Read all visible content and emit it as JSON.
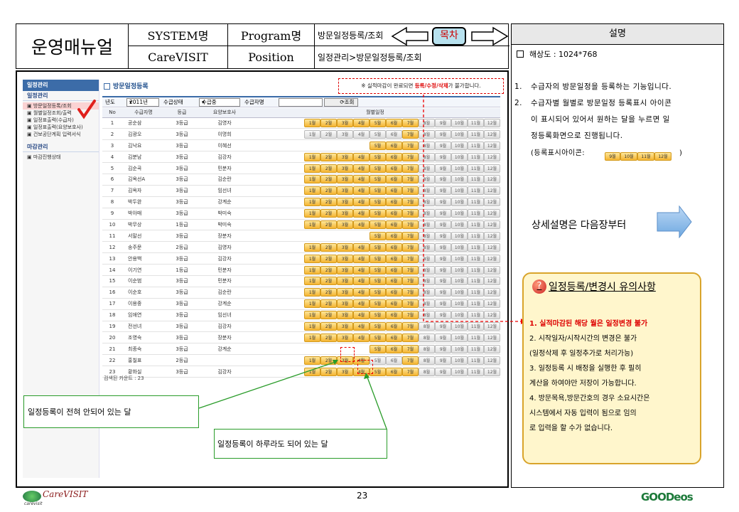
{
  "header": {
    "doc_title": "운영매뉴얼",
    "system_label": "SYSTEM명",
    "program_label": "Program명",
    "program_value": "방문일정등록/조회",
    "mokcha": "목차",
    "system_value": "CareVISIT",
    "position_label": "Position",
    "position_value": "일정관리>방문일정등록/조회"
  },
  "desc": {
    "head": "설명",
    "resolution": "해상도 : 1024*768",
    "item1_num": "1.",
    "item1": "수급자의 방문일정을 등록하는 기능입니다.",
    "item2_num": "2.",
    "item2_l1": "수급자별 월별로 방문일정 등록표시 아이콘",
    "item2_l2": "이 표시되어 있어서 원하는 달을 누르면 일",
    "item2_l3": "정등록화면으로 진행됩니다.",
    "item2_l4": "(등록표시아이콘:",
    "item2_l4_end": ")",
    "icon_samples": [
      "9월",
      "10월",
      "11월",
      "12월"
    ],
    "detail": "상세설명은 다음장부터"
  },
  "note": {
    "title": "일정등록/변경시 유의사항",
    "items": [
      "1.   실적마감된 해당 월은 일정변경 불가",
      "2.   시작일자/시작시간의 변경은 불가",
      "      (일정삭제 후 일정추가로 처리가능)",
      "3.   일정등록 시 배정을 실행한 후 필히",
      "      계산을 하여야만 저장이 가능합니다.",
      "4.   방문목욕,방문간호의 경우 소요시간은",
      "      시스템에서 자동 입력이 됨으로 임의",
      "      로 입력을 할 수가 없습니다."
    ]
  },
  "sidebar": {
    "head1": "일정관리",
    "sub1": "일정관리",
    "items": [
      "방문일정등록/조회",
      "월별일정조회/출력",
      "일정표출력(수급자)",
      "일정표출력(요양보호사)",
      "건보공단계획 입력서식"
    ],
    "head2": "마감관리",
    "items2": [
      "마감진행상태"
    ]
  },
  "screen": {
    "title": "방문일정등록",
    "warn_pre": "※ 실적마감이 완료되면",
    "warn_red": "등록/수정/삭제",
    "warn_post": "가 불가합니다.",
    "f_year_label": "년도",
    "f_year": "2011년",
    "f_status_label": "수급상태",
    "f_status": "수급중",
    "f_name_label": "수급자명",
    "f_search": "조회",
    "cols": [
      "No",
      "수급자명",
      "등급",
      "요양보호사",
      "월별일정"
    ],
    "count": "검색된 카운트 : 23"
  },
  "months": [
    "1월",
    "2월",
    "3월",
    "4월",
    "5월",
    "6월",
    "7월",
    "8월",
    "9월",
    "10월",
    "11월",
    "12월"
  ],
  "rows": [
    {
      "no": "1",
      "name": "공순삼",
      "grade": "3등급",
      "care": "김영자",
      "on": [
        1,
        1,
        1,
        1,
        1,
        1,
        1,
        0,
        0,
        0,
        0,
        0
      ]
    },
    {
      "no": "2",
      "name": "김광오",
      "grade": "3등급",
      "care": "이명희",
      "on": [
        0,
        0,
        0,
        0,
        0,
        0,
        1,
        0,
        0,
        0,
        0,
        0
      ]
    },
    {
      "no": "3",
      "name": "김낙요",
      "grade": "3등급",
      "care": "이혜선",
      "on": [
        null,
        null,
        null,
        null,
        1,
        1,
        1,
        0,
        0,
        0,
        0,
        0
      ]
    },
    {
      "no": "4",
      "name": "김분남",
      "grade": "3등급",
      "care": "김강자",
      "on": [
        1,
        1,
        1,
        1,
        1,
        1,
        1,
        0,
        0,
        0,
        0,
        0
      ]
    },
    {
      "no": "5",
      "name": "김순곡",
      "grade": "3등급",
      "care": "민분자",
      "on": [
        1,
        1,
        1,
        1,
        1,
        1,
        1,
        0,
        0,
        0,
        0,
        0
      ]
    },
    {
      "no": "6",
      "name": "김옥선A",
      "grade": "3등급",
      "care": "김순란",
      "on": [
        1,
        1,
        1,
        1,
        1,
        1,
        1,
        0,
        0,
        0,
        0,
        0
      ]
    },
    {
      "no": "7",
      "name": "김옥자",
      "grade": "3등급",
      "care": "임선녀",
      "on": [
        1,
        1,
        1,
        1,
        1,
        1,
        1,
        0,
        0,
        0,
        0,
        0
      ]
    },
    {
      "no": "8",
      "name": "박두완",
      "grade": "3등급",
      "care": "강계순",
      "on": [
        1,
        1,
        1,
        1,
        1,
        1,
        1,
        0,
        0,
        0,
        0,
        0
      ]
    },
    {
      "no": "9",
      "name": "박아매",
      "grade": "3등급",
      "care": "박미숙",
      "on": [
        1,
        1,
        1,
        1,
        1,
        1,
        1,
        0,
        0,
        0,
        0,
        0
      ]
    },
    {
      "no": "10",
      "name": "박무상",
      "grade": "1등급",
      "care": "박미숙",
      "on": [
        1,
        1,
        1,
        1,
        1,
        1,
        1,
        0,
        0,
        0,
        0,
        0
      ]
    },
    {
      "no": "11",
      "name": "서말선",
      "grade": "3등급",
      "care": "장분자",
      "on": [
        null,
        null,
        null,
        null,
        1,
        1,
        1,
        0,
        0,
        0,
        0,
        0
      ]
    },
    {
      "no": "12",
      "name": "송주문",
      "grade": "2등급",
      "care": "김영자",
      "on": [
        1,
        1,
        1,
        1,
        1,
        1,
        1,
        0,
        0,
        0,
        0,
        0
      ]
    },
    {
      "no": "13",
      "name": "안용백",
      "grade": "3등급",
      "care": "김강자",
      "on": [
        1,
        1,
        1,
        1,
        1,
        1,
        1,
        0,
        0,
        0,
        0,
        0
      ]
    },
    {
      "no": "14",
      "name": "이기연",
      "grade": "1등급",
      "care": "민분자",
      "on": [
        1,
        1,
        1,
        1,
        1,
        1,
        1,
        0,
        0,
        0,
        0,
        0
      ]
    },
    {
      "no": "15",
      "name": "이순범",
      "grade": "3등급",
      "care": "민분자",
      "on": [
        1,
        1,
        1,
        1,
        1,
        1,
        1,
        0,
        0,
        0,
        0,
        0
      ]
    },
    {
      "no": "16",
      "name": "이순호",
      "grade": "3등급",
      "care": "김순란",
      "on": [
        1,
        1,
        1,
        1,
        1,
        1,
        1,
        0,
        0,
        0,
        0,
        0
      ]
    },
    {
      "no": "17",
      "name": "이용중",
      "grade": "3등급",
      "care": "강계순",
      "on": [
        1,
        1,
        1,
        1,
        1,
        1,
        1,
        0,
        0,
        0,
        0,
        0
      ]
    },
    {
      "no": "18",
      "name": "임애연",
      "grade": "3등급",
      "care": "임선녀",
      "on": [
        1,
        1,
        1,
        1,
        1,
        1,
        1,
        0,
        0,
        0,
        0,
        0
      ]
    },
    {
      "no": "19",
      "name": "전선녀",
      "grade": "3등급",
      "care": "김강자",
      "on": [
        1,
        1,
        1,
        1,
        1,
        1,
        1,
        0,
        0,
        0,
        0,
        0
      ]
    },
    {
      "no": "20",
      "name": "조영숙",
      "grade": "3등급",
      "care": "장분자",
      "on": [
        1,
        1,
        1,
        1,
        1,
        1,
        1,
        0,
        0,
        0,
        0,
        0
      ]
    },
    {
      "no": "21",
      "name": "최종숙",
      "grade": "3등급",
      "care": "강계순",
      "on": [
        null,
        null,
        null,
        null,
        1,
        1,
        1,
        0,
        0,
        0,
        0,
        0
      ]
    },
    {
      "no": "22",
      "name": "홍칠표",
      "grade": "2등급",
      "care": "",
      "on": [
        1,
        1,
        1,
        1,
        0,
        0,
        1,
        0,
        0,
        0,
        0,
        0
      ]
    },
    {
      "no": "23",
      "name": "황화실",
      "grade": "3등급",
      "care": "김강자",
      "on": [
        1,
        1,
        1,
        1,
        1,
        1,
        1,
        0,
        0,
        0,
        0,
        0
      ]
    }
  ],
  "callouts": {
    "none": "일정등록이 전혀 안되어 있는 달",
    "some": "일정등록이 하루라도 되어 있는 달"
  },
  "footer": {
    "logo_left": "CareVISIT",
    "logo_left_sub": "carevisit",
    "page": "23",
    "logo_right": "GOODeos"
  }
}
